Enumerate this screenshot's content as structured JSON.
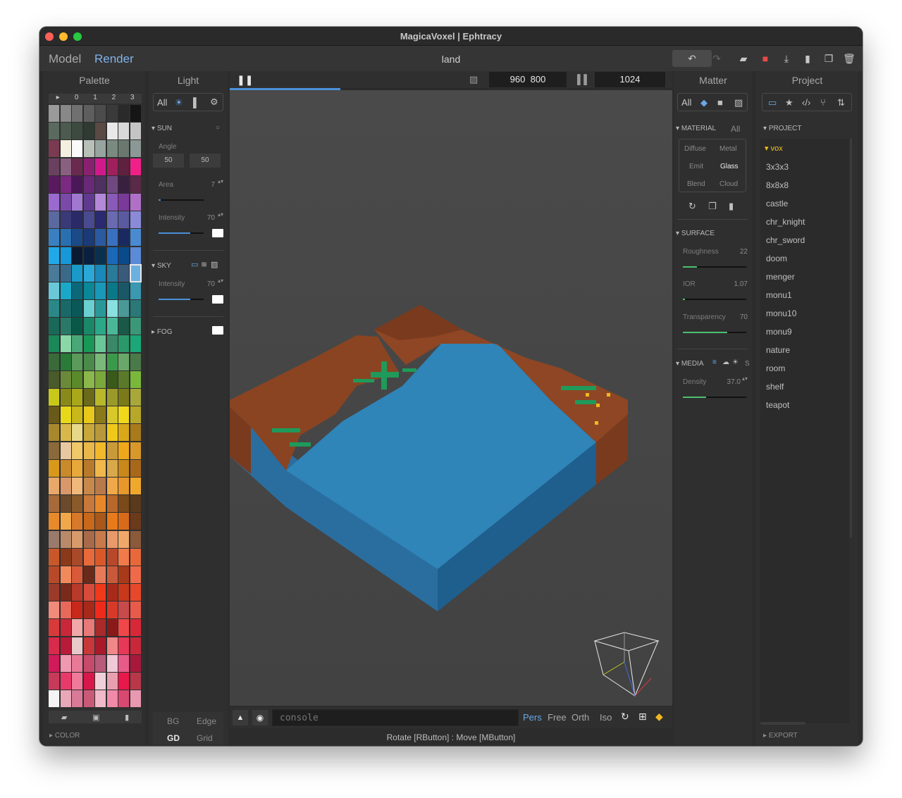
{
  "window": {
    "title": "MagicaVoxel | Ephtracy"
  },
  "toolbar": {
    "modes": [
      "Model",
      "Render"
    ],
    "filename": "land",
    "icons": [
      "undo-icon",
      "redo-icon",
      "open-folder-icon",
      "save-icon",
      "export-icon",
      "new-file-icon",
      "copy-icon",
      "trash-icon"
    ]
  },
  "palette": {
    "title": "Palette",
    "tabs": [
      "▸",
      "0",
      "1",
      "2",
      "3"
    ],
    "footer_label": "COLOR",
    "colors": [
      "#9a9a9a",
      "#888888",
      "#707070",
      "#5e5e5e",
      "#4c4c4c",
      "#3a3a3a",
      "#2a2a2a",
      "#151515",
      "#5a6a5e",
      "#4c5a50",
      "#3c4a40",
      "#2e3a32",
      "#5a4a44",
      "#e8e8e8",
      "#d8d8d8",
      "#c4c4c4",
      "#7a3a50",
      "#f4f0e0",
      "#fafafa",
      "#b8c0b8",
      "#98a4a0",
      "#7a8a80",
      "#6a7870",
      "#8c9896",
      "#6a4060",
      "#8a6080",
      "#6a2a50",
      "#8a2070",
      "#d01a8c",
      "#a0205c",
      "#602040",
      "#f02088",
      "#5a1a60",
      "#7a2a80",
      "#4a1858",
      "#6a2878",
      "#503060",
      "#704880",
      "#3a2040",
      "#5a2a48",
      "#9a6ad0",
      "#7a4aa8",
      "#a078d0",
      "#603a90",
      "#b488d8",
      "#8a5ab8",
      "#7a3a9a",
      "#b070c8",
      "#5a6aa0",
      "#3a3a78",
      "#2a2a68",
      "#4a4a90",
      "#2a2a70",
      "#6a6ab0",
      "#5a5aa0",
      "#8a8ad8",
      "#3a80c0",
      "#2a70b0",
      "#1a4a88",
      "#1a3a78",
      "#2a5aa0",
      "#3a70c0",
      "#1a2a60",
      "#4a8ad0",
      "#20a8e8",
      "#1898d8",
      "#0a1a30",
      "#0a2040",
      "#0a3050",
      "#1a68b8",
      "#0a4a8a",
      "#5a8ad8",
      "#4a7a9a",
      "#3a6a8a",
      "#1a9ac8",
      "#2aa8d8",
      "#1a88b8",
      "#2a7a9a",
      "#3a5a7a",
      "#6ab0e0",
      "#6ac8d8",
      "#1aa8c8",
      "#0a6878",
      "#0a8898",
      "#1a98b8",
      "#0a7888",
      "#1a5868",
      "#3a98b0",
      "#2a8888",
      "#1a6868",
      "#0a5858",
      "#6ad0d0",
      "#2a9898",
      "#8ae0e0",
      "#4a9898",
      "#2a7878",
      "#1a6858",
      "#2a7868",
      "#0a5848",
      "#1a8868",
      "#2aa888",
      "#4ab898",
      "#1a5848",
      "#3a9878",
      "#1a8858",
      "#8ad8a8",
      "#4aa878",
      "#1a9858",
      "#6ac898",
      "#3a8868",
      "#2a9868",
      "#1aa878",
      "#3a6a3a",
      "#2a7a3a",
      "#5a9a5a",
      "#4a8a4a",
      "#7ab87a",
      "#3a9a4a",
      "#6aa86a",
      "#4a7a4a",
      "#4a5a2a",
      "#6a8a3a",
      "#5a8a2a",
      "#8ab84a",
      "#7aa83a",
      "#3a5a1a",
      "#5a7a2a",
      "#7ab83a",
      "#c8c81a",
      "#8a8a1a",
      "#a8a81a",
      "#6a6a1a",
      "#b8b82a",
      "#9a9a2a",
      "#7a7a1a",
      "#a8a83a",
      "#6a5a1a",
      "#e8d81a",
      "#c8b81a",
      "#e8c81a",
      "#8a7a1a",
      "#d8c82a",
      "#f0d81a",
      "#b8a82a",
      "#a8882a",
      "#d8b84a",
      "#e8d88a",
      "#c8a83a",
      "#b8983a",
      "#f0c81a",
      "#d8a81a",
      "#a87a1a",
      "#8a6a3a",
      "#e8c8a0",
      "#f0c86a",
      "#e8b84a",
      "#f0b82a",
      "#c89a3a",
      "#f0a81a",
      "#d8982a",
      "#d8981a",
      "#c88a2a",
      "#e8a83a",
      "#b87a2a",
      "#f0b84a",
      "#d8a84a",
      "#c8881a",
      "#a8681a",
      "#e8a86a",
      "#d8986a",
      "#f0b87a",
      "#c8884a",
      "#b87a4a",
      "#f0a84a",
      "#e8982a",
      "#f0a82a",
      "#a86a3a",
      "#6a4a2a",
      "#8a5a2a",
      "#c8783a",
      "#e8882a",
      "#b8682a",
      "#7a4a1a",
      "#5a3a1a",
      "#e88a2a",
      "#f0a84a",
      "#d8782a",
      "#c8681a",
      "#a8581a",
      "#e87a1a",
      "#d86a1a",
      "#6a3a1a",
      "#9a7a6a",
      "#b88a6a",
      "#d89a6a",
      "#a86a4a",
      "#c87a4a",
      "#e89a6a",
      "#f0a86a",
      "#8a5a3a",
      "#c8582a",
      "#8a3a1a",
      "#a84a2a",
      "#e86a3a",
      "#d8582a",
      "#b8482a",
      "#f07a4a",
      "#e8683a",
      "#b84a2a",
      "#f08a5a",
      "#d85a3a",
      "#6a2a1a",
      "#e87a5a",
      "#c85a3a",
      "#a83a1a",
      "#f06a4a",
      "#9a3a2a",
      "#7a2a1a",
      "#b83a2a",
      "#d84a3a",
      "#f0381a",
      "#a82a1a",
      "#c8381a",
      "#e8482a",
      "#f08a7a",
      "#e8685a",
      "#c8281a",
      "#a8281a",
      "#f02a1a",
      "#d83a2a",
      "#c84a4a",
      "#e85a4a",
      "#d83a3a",
      "#c8283a",
      "#f0a8a8",
      "#e87a7a",
      "#a82a2a",
      "#8a1a1a",
      "#f04848",
      "#d82838",
      "#d82a4a",
      "#b81a3a",
      "#e8c8c8",
      "#c8383a",
      "#a81a2a",
      "#f08888",
      "#e83858",
      "#c8283a",
      "#d01a5a",
      "#f098b0",
      "#e87a98",
      "#c84a6a",
      "#b85a7a",
      "#f0c8d8",
      "#e85a88",
      "#a8183a",
      "#c83a5a",
      "#e83a6a",
      "#f07a9a",
      "#d8184a",
      "#f0d0d8",
      "#e8a0b0",
      "#e8184a",
      "#b8384a",
      "#f4f4f4",
      "#e8a8b8",
      "#d87a98",
      "#c85a78",
      "#f0b8c8",
      "#f08aa8",
      "#d84870",
      "#e898b0"
    ]
  },
  "light": {
    "title": "Light",
    "filter_all": "All",
    "sun": {
      "label": "SUN",
      "angle_label": "Angle",
      "angle1": "50",
      "angle2": "50",
      "area_label": "Area",
      "area": "7",
      "intensity_label": "Intensity",
      "intensity": "70",
      "area_level": 0.05,
      "intensity_level": 0.7
    },
    "sky": {
      "label": "SKY",
      "intensity_label": "Intensity",
      "intensity": "70",
      "intensity_level": 0.7
    },
    "fog": {
      "label": "FOG"
    },
    "bottom": {
      "bg": "BG",
      "edge": "Edge",
      "gd": "GD",
      "grid": "Grid"
    }
  },
  "render": {
    "width": "960",
    "height": "800",
    "samples": "1024",
    "progress_level": 0.25,
    "console_placeholder": "console",
    "view_modes": [
      "Pers",
      "Free",
      "Orth",
      "Iso"
    ],
    "status": "Rotate [RButton] : Move [MButton]"
  },
  "matter": {
    "title": "Matter",
    "filter_all": "All",
    "material_label": "MATERIAL",
    "material_all": "All",
    "materials": [
      "Diffuse",
      "Metal",
      "Emit",
      "Glass",
      "Blend",
      "Cloud"
    ],
    "surface_label": "SURFACE",
    "roughness_label": "Roughness",
    "roughness": "22",
    "roughness_level": 0.22,
    "ior_label": "IOR",
    "ior": "1.07",
    "ior_level": 0.03,
    "transparency_label": "Transparency",
    "transparency": "70",
    "transparency_level": 0.7,
    "media_label": "MEDIA",
    "media_s": "S",
    "density_label": "Density",
    "density": "37.0",
    "density_level": 0.37
  },
  "project": {
    "title": "Project",
    "section_label": "PROJECT",
    "folder": "vox",
    "items": [
      "3x3x3",
      "8x8x8",
      "castle",
      "chr_knight",
      "chr_sword",
      "doom",
      "menger",
      "monu1",
      "monu10",
      "monu9",
      "nature",
      "room",
      "shelf",
      "teapot"
    ],
    "export_label": "EXPORT"
  },
  "colors": {
    "accent": "#7fb2e8",
    "selected_item": "#f0c020",
    "slider_blue": "#4a90d8",
    "slider_green": "#4ac070"
  }
}
